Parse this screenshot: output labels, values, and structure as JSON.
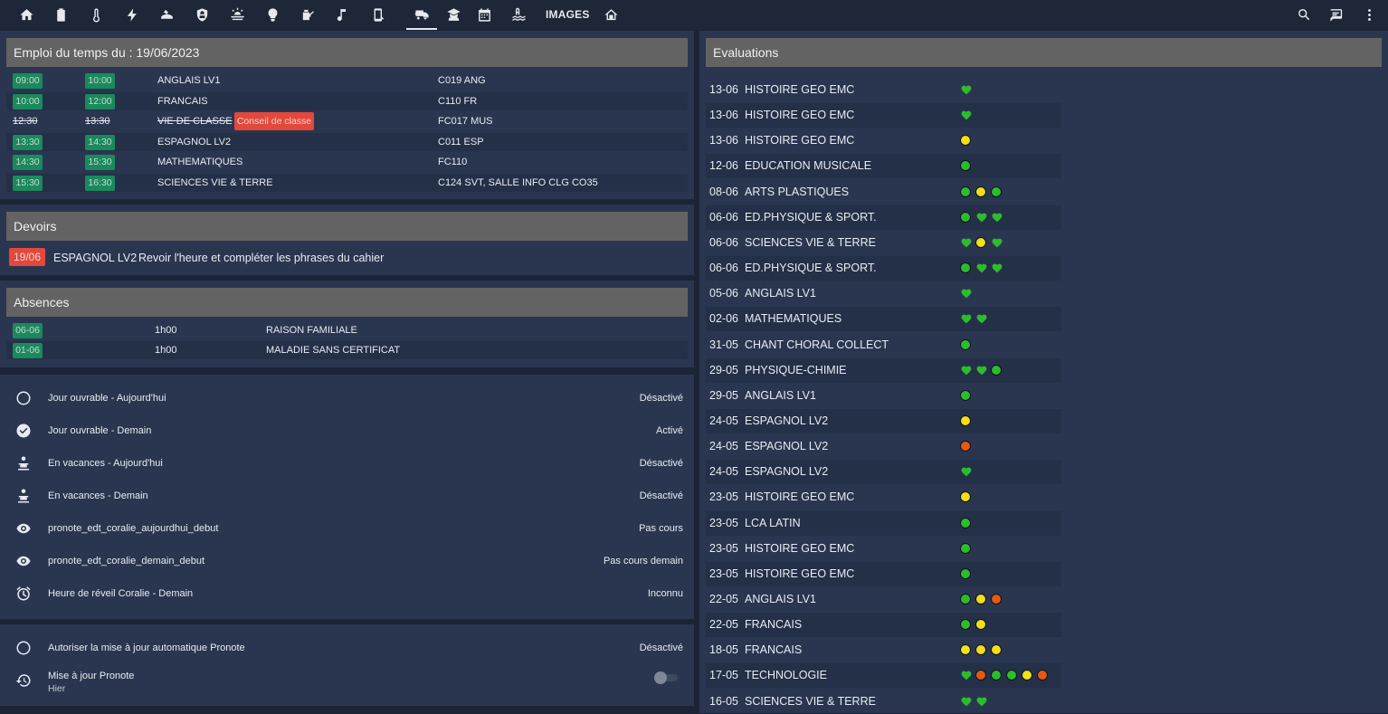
{
  "nav": {
    "icons": [
      "home-icon",
      "battery-icon",
      "thermometer-icon",
      "flash-icon",
      "robot-vacuum-icon",
      "shield-icon",
      "weather-icon",
      "lightbulb-icon",
      "watering-can-icon",
      "music-icon",
      "phone-icon",
      "delivery-truck-icon",
      "student-icon",
      "calendar-icon",
      "pool-icon"
    ],
    "images_label": "IMAGES",
    "right_icons": [
      "search-icon",
      "chat-icon",
      "more-vert-icon"
    ]
  },
  "edt": {
    "title": "Emploi du temps du : 19/06/2023",
    "rows": [
      {
        "start": "09:00",
        "end": "10:00",
        "subject": "ANGLAIS LV1",
        "room": "C019 ANG",
        "cancelled": false,
        "note": ""
      },
      {
        "start": "10:00",
        "end": "12:00",
        "subject": "FRANCAIS",
        "room": "C110 FR",
        "cancelled": false,
        "note": ""
      },
      {
        "start": "12:30",
        "end": "13:30",
        "subject": "VIE DE CLASSE",
        "room": "FC017 MUS",
        "cancelled": true,
        "note": "Conseil de classe"
      },
      {
        "start": "13:30",
        "end": "14:30",
        "subject": "ESPAGNOL LV2",
        "room": "C011 ESP",
        "cancelled": false,
        "note": ""
      },
      {
        "start": "14:30",
        "end": "15:30",
        "subject": "MATHEMATIQUES",
        "room": "FC110",
        "cancelled": false,
        "note": ""
      },
      {
        "start": "15:30",
        "end": "16:30",
        "subject": "SCIENCES VIE & TERRE",
        "room": "C124 SVT, SALLE INFO CLG CO35",
        "cancelled": false,
        "note": ""
      }
    ]
  },
  "devoirs": {
    "title": "Devoirs",
    "items": [
      {
        "date": "19/06",
        "subject": "ESPAGNOL LV2",
        "text": "Revoir l'heure et compléter les phrases du cahier"
      }
    ]
  },
  "absences": {
    "title": "Absences",
    "items": [
      {
        "date": "06-06",
        "duration": "1h00",
        "reason": "RAISON FAMILIALE"
      },
      {
        "date": "01-06",
        "duration": "1h00",
        "reason": "MALADIE SANS CERTIFICAT"
      }
    ]
  },
  "entities": [
    {
      "icon": "circle-outline-icon",
      "name": "Jour ouvrable - Aujourd'hui",
      "state": "Désactivé"
    },
    {
      "icon": "check-circle-icon",
      "name": "Jour ouvrable - Demain",
      "state": "Activé"
    },
    {
      "icon": "beach-person-icon",
      "name": "En vacances - Aujourd'hui",
      "state": "Désactivé"
    },
    {
      "icon": "beach-person-icon",
      "name": "En vacances - Demain",
      "state": "Désactivé"
    },
    {
      "icon": "eye-icon",
      "name": "pronote_edt_coralie_aujourdhui_debut",
      "state": "Pas cours"
    },
    {
      "icon": "eye-icon",
      "name": "pronote_edt_coralie_demain_debut",
      "state": "Pas cours demain"
    },
    {
      "icon": "alarm-icon",
      "name": "Heure de réveil Coralie - Demain",
      "state": "Inconnu"
    }
  ],
  "pronote": {
    "auto_update": {
      "icon": "circle-outline-icon",
      "name": "Autoriser la mise à jour automatique Pronote",
      "state": "Désactivé"
    },
    "update": {
      "icon": "history-icon",
      "name": "Mise à jour Pronote",
      "sub": "Hier",
      "toggle_on": false
    }
  },
  "evaluations": {
    "title": "Evaluations",
    "rows": [
      {
        "date": "13-06",
        "subject": "HISTOIRE GEO EMC",
        "marks": [
          "heart"
        ]
      },
      {
        "date": "13-06",
        "subject": "HISTOIRE GEO EMC",
        "marks": [
          "heart"
        ]
      },
      {
        "date": "13-06",
        "subject": "HISTOIRE GEO EMC",
        "marks": [
          "yellow"
        ]
      },
      {
        "date": "12-06",
        "subject": "EDUCATION MUSICALE",
        "marks": [
          "green"
        ]
      },
      {
        "date": "08-06",
        "subject": "ARTS PLASTIQUES",
        "marks": [
          "green",
          "yellow",
          "green"
        ]
      },
      {
        "date": "06-06",
        "subject": "ED.PHYSIQUE & SPORT.",
        "marks": [
          "green",
          "heart",
          "heart"
        ]
      },
      {
        "date": "06-06",
        "subject": "SCIENCES VIE & TERRE",
        "marks": [
          "heart",
          "yellow",
          "heart"
        ]
      },
      {
        "date": "06-06",
        "subject": "ED.PHYSIQUE & SPORT.",
        "marks": [
          "green",
          "heart",
          "heart"
        ]
      },
      {
        "date": "05-06",
        "subject": "ANGLAIS LV1",
        "marks": [
          "heart"
        ]
      },
      {
        "date": "02-06",
        "subject": "MATHEMATIQUES",
        "marks": [
          "heart",
          "heart"
        ]
      },
      {
        "date": "31-05",
        "subject": "CHANT CHORAL COLLECT",
        "marks": [
          "green"
        ]
      },
      {
        "date": "29-05",
        "subject": "PHYSIQUE-CHIMIE",
        "marks": [
          "heart",
          "heart",
          "green"
        ]
      },
      {
        "date": "29-05",
        "subject": "ANGLAIS LV1",
        "marks": [
          "green"
        ]
      },
      {
        "date": "24-05",
        "subject": "ESPAGNOL LV2",
        "marks": [
          "yellow"
        ]
      },
      {
        "date": "24-05",
        "subject": "ESPAGNOL LV2",
        "marks": [
          "orange"
        ]
      },
      {
        "date": "24-05",
        "subject": "ESPAGNOL LV2",
        "marks": [
          "heart"
        ]
      },
      {
        "date": "23-05",
        "subject": "HISTOIRE GEO EMC",
        "marks": [
          "yellow"
        ]
      },
      {
        "date": "23-05",
        "subject": "LCA LATIN",
        "marks": [
          "green"
        ]
      },
      {
        "date": "23-05",
        "subject": "HISTOIRE GEO EMC",
        "marks": [
          "green"
        ]
      },
      {
        "date": "23-05",
        "subject": "HISTOIRE GEO EMC",
        "marks": [
          "green"
        ]
      },
      {
        "date": "22-05",
        "subject": "ANGLAIS LV1",
        "marks": [
          "green",
          "yellow",
          "orange"
        ]
      },
      {
        "date": "22-05",
        "subject": "FRANCAIS",
        "marks": [
          "green",
          "yellow"
        ]
      },
      {
        "date": "18-05",
        "subject": "FRANCAIS",
        "marks": [
          "yellow",
          "yellow",
          "yellow"
        ]
      },
      {
        "date": "17-05",
        "subject": "TECHNOLOGIE",
        "marks": [
          "heart",
          "orange",
          "green",
          "green",
          "yellow",
          "orange"
        ]
      },
      {
        "date": "16-05",
        "subject": "SCIENCES VIE & TERRE",
        "marks": [
          "heart",
          "heart"
        ]
      }
    ]
  },
  "colors": {
    "accent_green": "#1a8a5e",
    "alert_red": "#e3483c",
    "mark_green": "#2cbc2c",
    "mark_yellow": "#f1df17",
    "mark_orange": "#e55a12",
    "header_grey": "#636363",
    "card_bg": "#2a3650",
    "page_bg": "#1c2536"
  }
}
